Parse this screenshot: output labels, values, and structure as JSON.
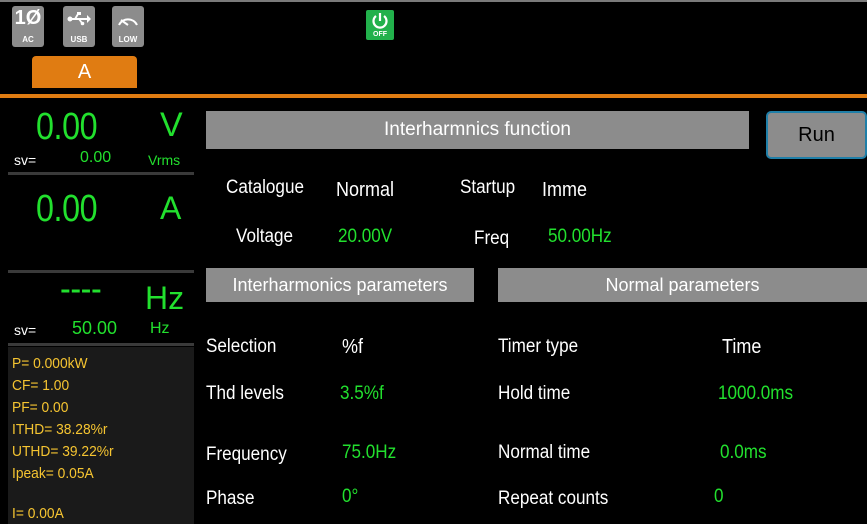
{
  "status": {
    "ac_glyph": "1Ø",
    "ac_caption": "AC",
    "usb_caption": "USB",
    "low_caption": "LOW",
    "power_caption": "OFF"
  },
  "channel_tab": "A",
  "meter": {
    "voltage_value": "0.00",
    "voltage_unit": "V",
    "voltage_sv_label": "sv=",
    "voltage_sv_value": "0.00",
    "voltage_sv_unit": "Vrms",
    "current_value": "0.00",
    "current_unit": "A",
    "freq_value": "----",
    "freq_unit": "Hz",
    "freq_sv_label": "sv=",
    "freq_sv_value": "50.00",
    "freq_sv_unit": "Hz",
    "readings": [
      "P= 0.000kW",
      "CF= 1.00",
      "PF= 0.00",
      "ITHD= 38.28%r",
      "UTHD= 39.22%r",
      "Ipeak= 0.05A",
      "I=  0.00A"
    ]
  },
  "main": {
    "title": "Interharmnics function",
    "run_label": "Run",
    "catalogue_label": "Catalogue",
    "catalogue_value": "Normal",
    "startup_label": "Startup",
    "startup_value": "Imme",
    "voltage_label": "Voltage",
    "voltage_value": "20.00V",
    "freq_label": "Freq",
    "freq_value": "50.00Hz",
    "inter_header": "Interharmonics parameters",
    "normal_header": "Normal parameters",
    "selection_label": "Selection",
    "selection_value": "%f",
    "thd_label": "Thd levels",
    "thd_value": "3.5%f",
    "frequency_label": "Frequency",
    "frequency_value": "75.0Hz",
    "phase_label": "Phase",
    "phase_value": "0°",
    "timer_type_label": "Timer type",
    "timer_type_value": "Time",
    "hold_time_label": "Hold time",
    "hold_time_value": "1000.0ms",
    "normal_time_label": "Normal time",
    "normal_time_value": "0.0ms",
    "repeat_label": "Repeat counts",
    "repeat_value": "0"
  },
  "colors": {
    "accent_orange": "#e07c12",
    "value_green": "#22e02e",
    "reading_yellow": "#f5c431",
    "header_gray": "#8c8c8c",
    "run_border": "#1f7fa8"
  }
}
